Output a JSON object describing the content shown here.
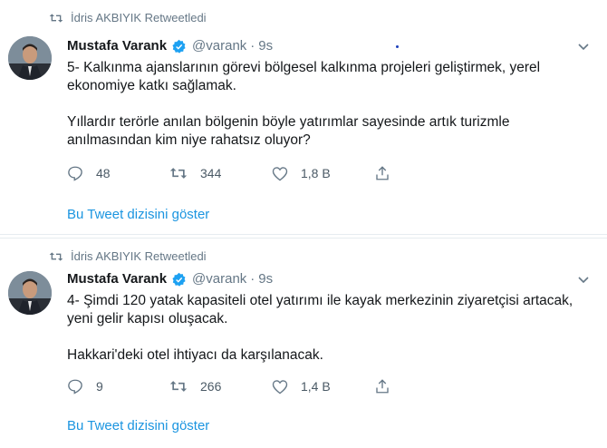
{
  "tweets": [
    {
      "retweeted_by": "İdris AKBIYIK Retweetledi",
      "author_name": "Mustafa Varank",
      "author_handle": "@varank",
      "separator": "·",
      "time": "9s",
      "paragraphs": [
        "5- Kalkınma ajanslarının görevi bölgesel kalkınma projeleri geliştirmek, yerel ekonomiye katkı sağlamak.",
        "Yıllardır terörle anılan bölgenin böyle yatırımlar sayesinde artık turizmle anılmasından kim niye rahatsız oluyor?"
      ],
      "replies": "48",
      "retweets": "344",
      "likes": "1,8 B",
      "show_thread": "Bu Tweet dizisini göster"
    },
    {
      "retweeted_by": "İdris AKBIYIK Retweetledi",
      "author_name": "Mustafa Varank",
      "author_handle": "@varank",
      "separator": "·",
      "time": "9s",
      "paragraphs": [
        "4- Şimdi 120 yatak kapasiteli otel yatırımı ile kayak merkezinin ziyaretçisi artacak, yeni gelir kapısı oluşacak.",
        "Hakkari'deki otel ihtiyacı da karşılanacak."
      ],
      "replies": "9",
      "retweets": "266",
      "likes": "1,4 B",
      "show_thread": "Bu Tweet dizisini göster"
    }
  ],
  "colors": {
    "link": "#1b95e0",
    "secondary_text": "#657786",
    "verified": "#1da1f2"
  },
  "icons": [
    "retweet-icon",
    "verified-icon",
    "chevron-down-icon",
    "reply-icon",
    "like-icon",
    "share-icon"
  ]
}
